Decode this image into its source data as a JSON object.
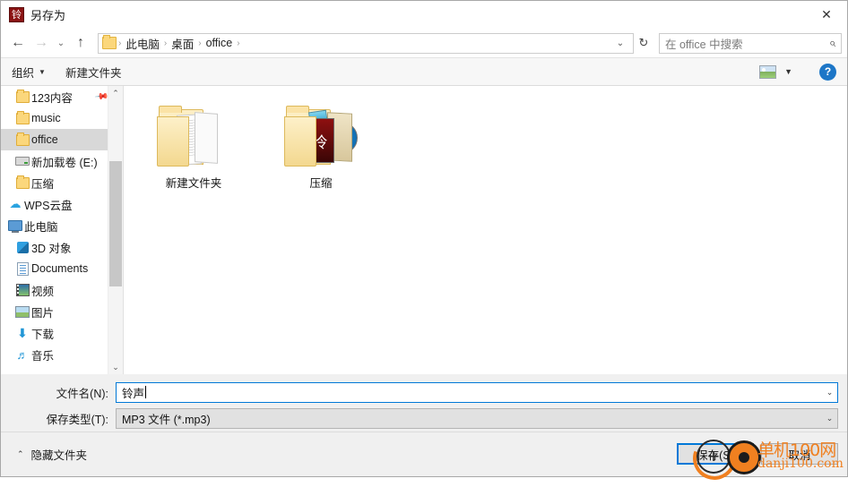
{
  "window": {
    "title": "另存为",
    "icon_glyph": "铃",
    "close_label": "✕"
  },
  "nav": {
    "back_icon": "←",
    "forward_icon": "→",
    "recent_icon": "⌄",
    "up_icon": "↑",
    "breadcrumbs": [
      "此电脑",
      "桌面",
      "office"
    ],
    "separator": "›",
    "dropdown_icon": "⌄",
    "refresh_icon": "↻"
  },
  "search": {
    "placeholder": "在 office 中搜索",
    "icon": "⌕"
  },
  "toolbar": {
    "organize_label": "组织",
    "organize_caret": "▼",
    "new_folder_label": "新建文件夹",
    "view_caret": "▼",
    "help_label": "?"
  },
  "sidebar": {
    "items": [
      {
        "label": "123内容",
        "icon": "folder-icon",
        "pinned": true,
        "selected": false,
        "indent": true
      },
      {
        "label": "music",
        "icon": "folder-icon",
        "pinned": false,
        "selected": false,
        "indent": true
      },
      {
        "label": "office",
        "icon": "folder-icon",
        "pinned": false,
        "selected": true,
        "indent": true
      },
      {
        "label": "新加载卷 (E:)",
        "icon": "drive-icon",
        "pinned": false,
        "selected": false,
        "indent": true
      },
      {
        "label": "压缩",
        "icon": "folder-icon",
        "pinned": false,
        "selected": false,
        "indent": true
      },
      {
        "label": "WPS云盘",
        "icon": "cloud-icon",
        "pinned": false,
        "selected": false,
        "indent": false
      },
      {
        "label": "此电脑",
        "icon": "computer-icon",
        "pinned": false,
        "selected": false,
        "indent": false
      },
      {
        "label": "3D 对象",
        "icon": "cube-icon",
        "pinned": false,
        "selected": false,
        "indent": true
      },
      {
        "label": "Documents",
        "icon": "document-icon",
        "pinned": false,
        "selected": false,
        "indent": true
      },
      {
        "label": "视频",
        "icon": "video-icon",
        "pinned": false,
        "selected": false,
        "indent": true
      },
      {
        "label": "图片",
        "icon": "picture-icon",
        "pinned": false,
        "selected": false,
        "indent": true
      },
      {
        "label": "下载",
        "icon": "download-icon",
        "pinned": false,
        "selected": false,
        "indent": true
      },
      {
        "label": "音乐",
        "icon": "music-icon",
        "pinned": false,
        "selected": false,
        "indent": true
      }
    ],
    "scroll_up_icon": "⌃",
    "scroll_down_icon": "⌄"
  },
  "files": [
    {
      "label": "新建文件夹",
      "type": "folder-documents"
    },
    {
      "label": "压缩",
      "type": "folder-media",
      "badge_glyph": "冷"
    }
  ],
  "form": {
    "filename_label": "文件名(N):",
    "filename_value": "铃声",
    "filetype_label": "保存类型(T):",
    "filetype_value": "MP3 文件 (*.mp3)",
    "caret_icon": "⌄"
  },
  "footer": {
    "hide_folders_label": "隐藏文件夹",
    "hide_folders_caret": "⌃",
    "save_label": "保存(S)",
    "cancel_label": "取消"
  },
  "watermark": {
    "plus": "+",
    "brand": "单机100网",
    "domain": "danji100.com",
    "accent_color": "#f08020"
  },
  "colors": {
    "focus_blue": "#0078d7",
    "selection_gray": "#d8d8d8",
    "chrome_gray": "#f0f0f0"
  }
}
